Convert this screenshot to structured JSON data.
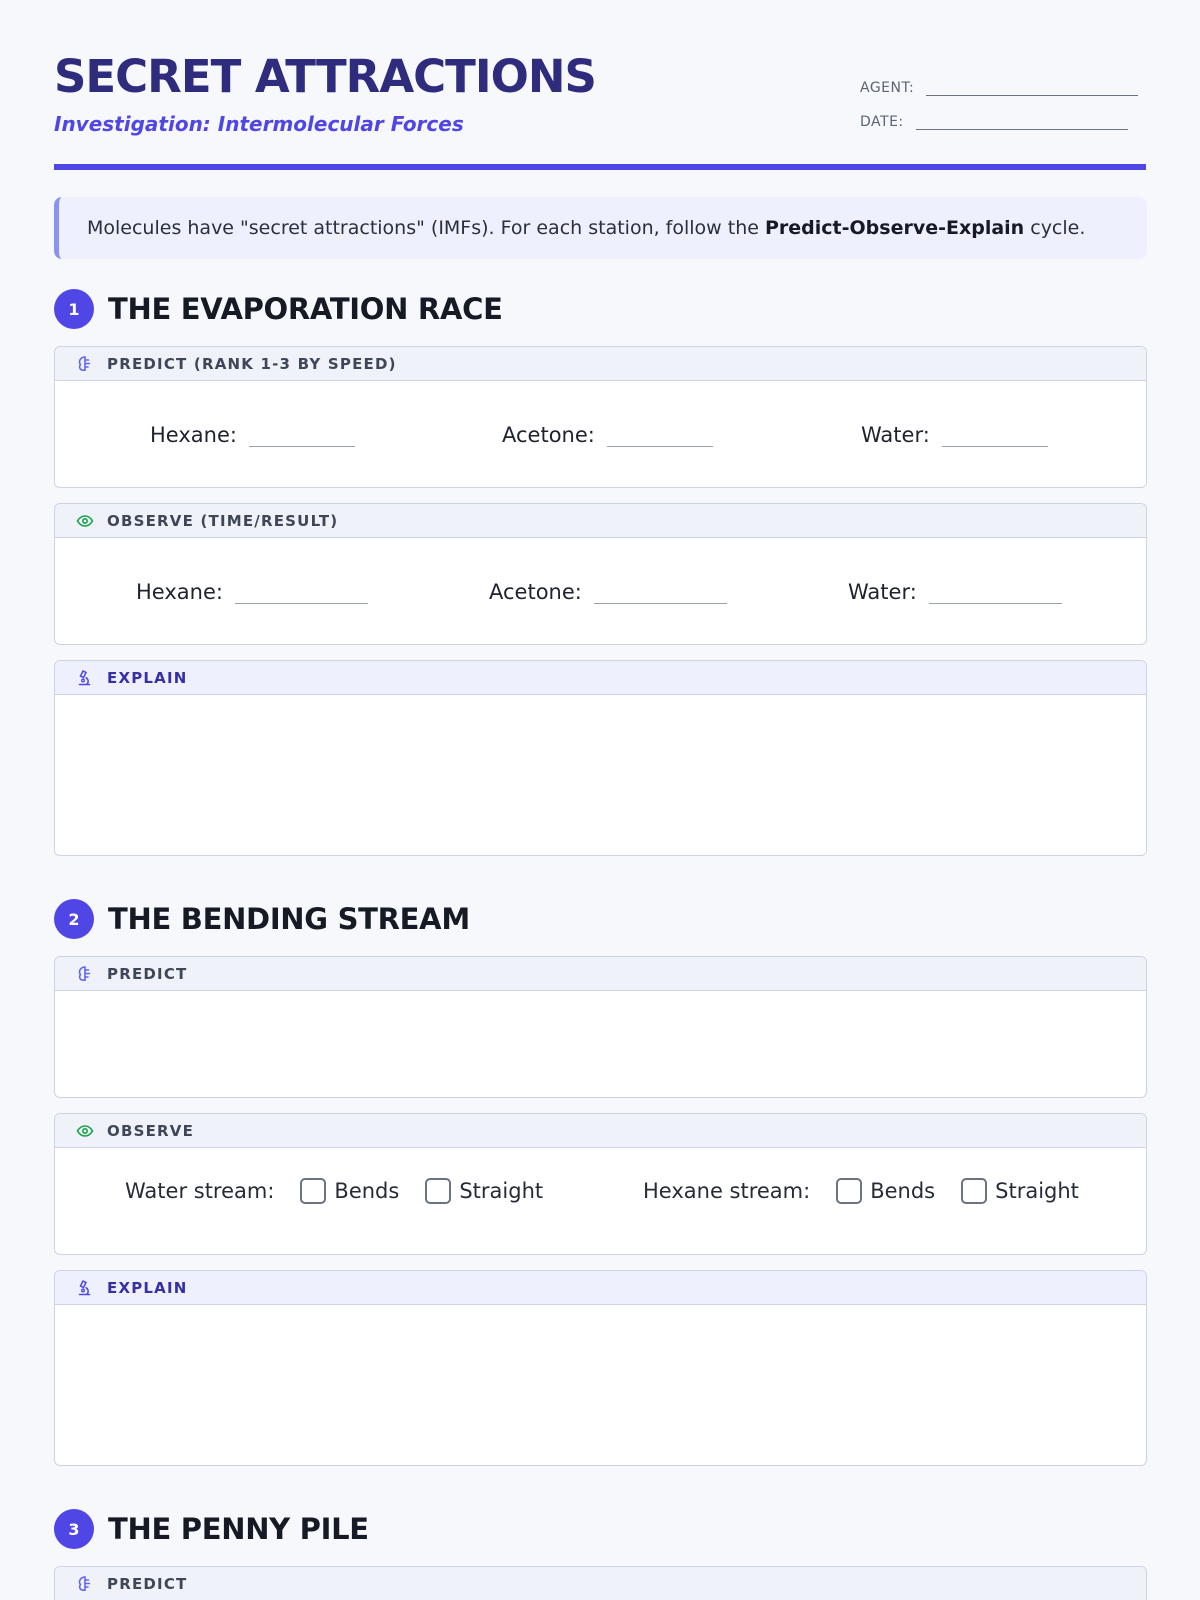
{
  "header": {
    "title": "SECRET ATTRACTIONS",
    "subtitle": "Investigation: Intermolecular Forces",
    "agent_label": "AGENT:",
    "date_label": "DATE:"
  },
  "intro": {
    "text_before": "Molecules have \"secret attractions\" (IMFs). For each station, follow the ",
    "bold": "Predict-Observe-Explain",
    "text_after": " cycle."
  },
  "stations": [
    {
      "number": "1",
      "title": "THE EVAPORATION RACE",
      "predict_label": "PREDICT (RANK 1-3 BY SPEED)",
      "predict_fields": [
        "Hexane:",
        "Acetone:",
        "Water:"
      ],
      "observe_label": "OBSERVE (TIME/RESULT)",
      "observe_fields": [
        "Hexane:",
        "Acetone:",
        "Water:"
      ],
      "explain_label": "EXPLAIN"
    },
    {
      "number": "2",
      "title": "THE BENDING STREAM",
      "predict_label": "PREDICT",
      "observe_label": "OBSERVE",
      "observe_checks": [
        {
          "label": "Water stream:",
          "options": [
            "Bends",
            "Straight"
          ]
        },
        {
          "label": "Hexane stream:",
          "options": [
            "Bends",
            "Straight"
          ]
        }
      ],
      "explain_label": "EXPLAIN"
    },
    {
      "number": "3",
      "title": "THE PENNY PILE",
      "predict_label": "PREDICT"
    }
  ],
  "icons": {
    "predict": "brain-icon",
    "observe": "eye-icon",
    "explain": "microscope-icon"
  },
  "colors": {
    "accent": "#4f46e5",
    "title": "#2f2b7d",
    "observe_icon": "#16a34a"
  }
}
